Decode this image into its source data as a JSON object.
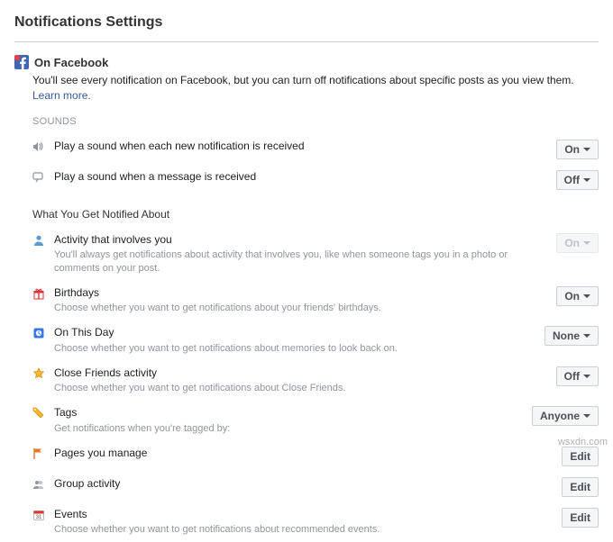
{
  "page": {
    "title": "Notifications Settings"
  },
  "section": {
    "title": "On Facebook",
    "description_prefix": "You'll see every notification on Facebook, but you can turn off notifications about specific posts as you view them. ",
    "learn_more": "Learn more."
  },
  "sounds": {
    "heading": "SOUNDS",
    "items": [
      {
        "label": "Play a sound when each new notification is received",
        "button": "On",
        "dropdown": true,
        "disabled": false
      },
      {
        "label": "Play a sound when a message is received",
        "button": "Off",
        "dropdown": true,
        "disabled": false
      }
    ]
  },
  "notified": {
    "heading": "What You Get Notified About",
    "items": [
      {
        "label": "Activity that involves you",
        "sub": "You'll always get notifications about activity that involves you, like when someone tags you in a photo or comments on your post.",
        "button": "On",
        "dropdown": true,
        "disabled": true
      },
      {
        "label": "Birthdays",
        "sub": "Choose whether you want to get notifications about your friends' birthdays.",
        "button": "On",
        "dropdown": true,
        "disabled": false
      },
      {
        "label": "On This Day",
        "sub": "Choose whether you want to get notifications about memories to look back on.",
        "button": "None",
        "dropdown": true,
        "disabled": false
      },
      {
        "label": "Close Friends activity",
        "sub": "Choose whether you want to get notifications about Close Friends.",
        "button": "Off",
        "dropdown": true,
        "disabled": false
      },
      {
        "label": "Tags",
        "sub": "Get notifications when you're tagged by:",
        "button": "Anyone",
        "dropdown": true,
        "disabled": false
      },
      {
        "label": "Pages you manage",
        "sub": "",
        "button": "Edit",
        "dropdown": false,
        "disabled": false
      },
      {
        "label": "Group activity",
        "sub": "",
        "button": "Edit",
        "dropdown": false,
        "disabled": false
      },
      {
        "label": "Events",
        "sub": "Choose whether you want to get notifications about recommended events.",
        "button": "Edit",
        "dropdown": false,
        "disabled": false
      }
    ]
  },
  "watermark": "wsxdn.com"
}
